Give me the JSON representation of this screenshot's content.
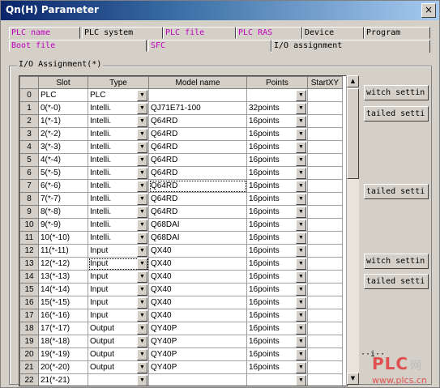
{
  "window": {
    "title": "Qn(H) Parameter",
    "close_label": "×"
  },
  "tabs_row1": [
    "PLC name",
    "PLC system",
    "PLC file",
    "PLC RAS",
    "Device",
    "Program"
  ],
  "tabs_row2": [
    "Boot file",
    "SFC",
    "I/O assignment"
  ],
  "group_label": "I/O Assignment(*)",
  "table": {
    "headers": [
      "Slot",
      "Type",
      "Model name",
      "Points",
      "StartXY"
    ],
    "rows": [
      {
        "num": "0",
        "slot": "PLC",
        "type": "PLC",
        "model": "",
        "points": "",
        "startxy": ""
      },
      {
        "num": "1",
        "slot": "0(*-0)",
        "type": "Intelli.",
        "model": "QJ71E71-100",
        "points": "32points",
        "startxy": ""
      },
      {
        "num": "2",
        "slot": "1(*-1)",
        "type": "Intelli.",
        "model": "Q64RD",
        "points": "16points",
        "startxy": ""
      },
      {
        "num": "3",
        "slot": "2(*-2)",
        "type": "Intelli.",
        "model": "Q64RD",
        "points": "16points",
        "startxy": ""
      },
      {
        "num": "4",
        "slot": "3(*-3)",
        "type": "Intelli.",
        "model": "Q64RD",
        "points": "16points",
        "startxy": ""
      },
      {
        "num": "5",
        "slot": "4(*-4)",
        "type": "Intelli.",
        "model": "Q64RD",
        "points": "16points",
        "startxy": ""
      },
      {
        "num": "6",
        "slot": "5(*-5)",
        "type": "Intelli.",
        "model": "Q64RD",
        "points": "16points",
        "startxy": ""
      },
      {
        "num": "7",
        "slot": "6(*-6)",
        "type": "Intelli.",
        "model": "Q64RD",
        "points": "16points",
        "startxy": ""
      },
      {
        "num": "8",
        "slot": "7(*-7)",
        "type": "Intelli.",
        "model": "Q64RD",
        "points": "16points",
        "startxy": ""
      },
      {
        "num": "9",
        "slot": "8(*-8)",
        "type": "Intelli.",
        "model": "Q64RD",
        "points": "16points",
        "startxy": ""
      },
      {
        "num": "10",
        "slot": "9(*-9)",
        "type": "Intelli.",
        "model": "Q68DAI",
        "points": "16points",
        "startxy": ""
      },
      {
        "num": "11",
        "slot": "10(*-10)",
        "type": "Intelli.",
        "model": "Q68DAI",
        "points": "16points",
        "startxy": ""
      },
      {
        "num": "12",
        "slot": "11(*-11)",
        "type": "Input",
        "model": "QX40",
        "points": "16points",
        "startxy": ""
      },
      {
        "num": "13",
        "slot": "12(*-12)",
        "type": "Input",
        "model": "QX40",
        "points": "16points",
        "startxy": ""
      },
      {
        "num": "14",
        "slot": "13(*-13)",
        "type": "Input",
        "model": "QX40",
        "points": "16points",
        "startxy": ""
      },
      {
        "num": "15",
        "slot": "14(*-14)",
        "type": "Input",
        "model": "QX40",
        "points": "16points",
        "startxy": ""
      },
      {
        "num": "16",
        "slot": "15(*-15)",
        "type": "Input",
        "model": "QX40",
        "points": "16points",
        "startxy": ""
      },
      {
        "num": "17",
        "slot": "16(*-16)",
        "type": "Input",
        "model": "QX40",
        "points": "16points",
        "startxy": ""
      },
      {
        "num": "18",
        "slot": "17(*-17)",
        "type": "Output",
        "model": "QY40P",
        "points": "16points",
        "startxy": ""
      },
      {
        "num": "19",
        "slot": "18(*-18)",
        "type": "Output",
        "model": "QY40P",
        "points": "16points",
        "startxy": ""
      },
      {
        "num": "20",
        "slot": "19(*-19)",
        "type": "Output",
        "model": "QY40P",
        "points": "16points",
        "startxy": ""
      },
      {
        "num": "21",
        "slot": "20(*-20)",
        "type": "Output",
        "model": "QY40P",
        "points": "16points",
        "startxy": ""
      },
      {
        "num": "22",
        "slot": "21(*-21)",
        "type": "",
        "model": "",
        "points": "",
        "startxy": ""
      }
    ]
  },
  "side_buttons": [
    "witch settin",
    "tailed setti",
    "tailed setti",
    "witch settin",
    "tailed setti"
  ],
  "truncated_label": "··i··",
  "watermark": {
    "brand": "PLC",
    "cn": "网",
    "url": "www.plcs.cn"
  },
  "colors": {
    "link_tab": "#c000c0",
    "title_start": "#0a246a",
    "watermark": "#e05050"
  },
  "icons": {
    "dropdown": "dropdown-arrow-icon",
    "scroll_up": "scroll-up-icon",
    "scroll_down": "scroll-down-icon"
  }
}
